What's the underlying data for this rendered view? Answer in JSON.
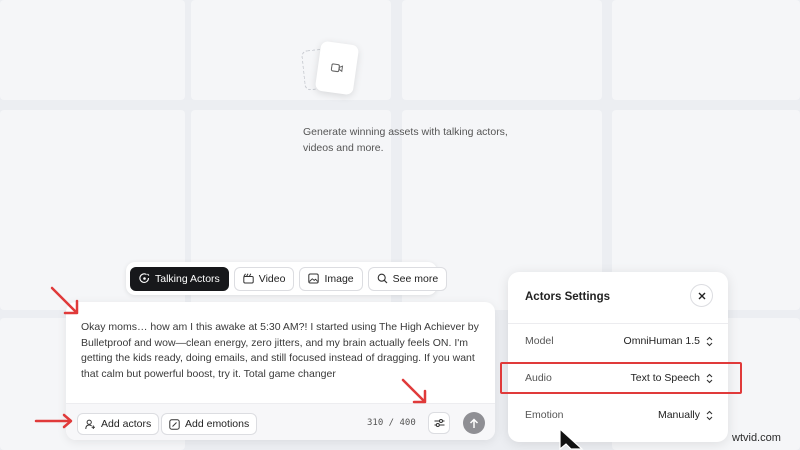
{
  "hero": {
    "tagline": "Generate winning assets with talking actors, videos and more."
  },
  "mode_tabs": [
    {
      "label": "Talking Actors",
      "icon": "talking-actor-icon",
      "active": true
    },
    {
      "label": "Video",
      "icon": "video-clapper-icon",
      "active": false
    },
    {
      "label": "Image",
      "icon": "image-icon",
      "active": false
    },
    {
      "label": "See more",
      "icon": "search-icon",
      "active": false
    }
  ],
  "prompt": {
    "text": "Okay moms… how am I this awake at 5:30 AM?! I started using The High Achiever by Bulletproof and wow—clean energy, zero jitters, and my brain actually feels ON. I'm getting the kids ready, doing emails, and still focused instead of dragging. If you want that calm but powerful boost, try it. Total game changer",
    "add_actors_label": "Add actors",
    "add_emotions_label": "Add emotions",
    "char_count": "310 / 400"
  },
  "actors_settings": {
    "title": "Actors Settings",
    "rows": [
      {
        "label": "Model",
        "value": "OmniHuman 1.5"
      },
      {
        "label": "Audio",
        "value": "Text to Speech"
      },
      {
        "label": "Emotion",
        "value": "Manually"
      }
    ]
  },
  "watermark": "wtvid.com",
  "colors": {
    "accent_dark": "#17181b",
    "annotation_red": "#e03a3a",
    "background": "#eceef2"
  }
}
